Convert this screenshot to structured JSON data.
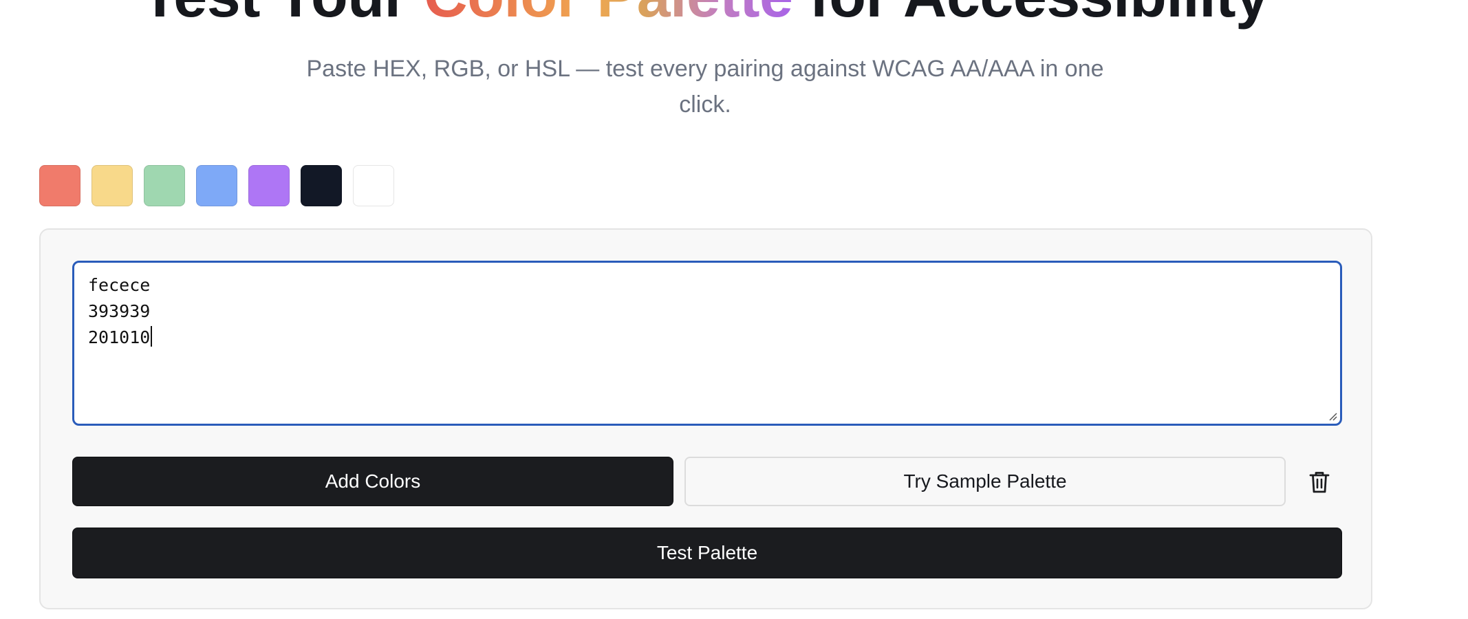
{
  "hero": {
    "title_prefix": "Test Your ",
    "title_highlight": "Color Palette",
    "title_suffix": " for Accessibility",
    "subtitle": "Paste HEX, RGB, or HSL — test every pairing against WCAG AA/AAA in one click."
  },
  "swatches": [
    {
      "name": "coral",
      "color": "#f07b6b"
    },
    {
      "name": "yellow",
      "color": "#f8d98a"
    },
    {
      "name": "green",
      "color": "#9fd7b0"
    },
    {
      "name": "blue",
      "color": "#7ea9f7"
    },
    {
      "name": "purple",
      "color": "#ae76f5"
    },
    {
      "name": "navy",
      "color": "#121826"
    },
    {
      "name": "white",
      "color": "#ffffff"
    }
  ],
  "input": {
    "lines": [
      "fecece",
      "393939",
      "201010"
    ]
  },
  "buttons": {
    "add_colors": "Add Colors",
    "try_sample": "Try Sample Palette",
    "test_palette": "Test Palette"
  },
  "icons": {
    "clear": "trash-icon"
  },
  "colors": {
    "focus_border": "#2a5cba",
    "button_dark": "#1b1c1f"
  }
}
